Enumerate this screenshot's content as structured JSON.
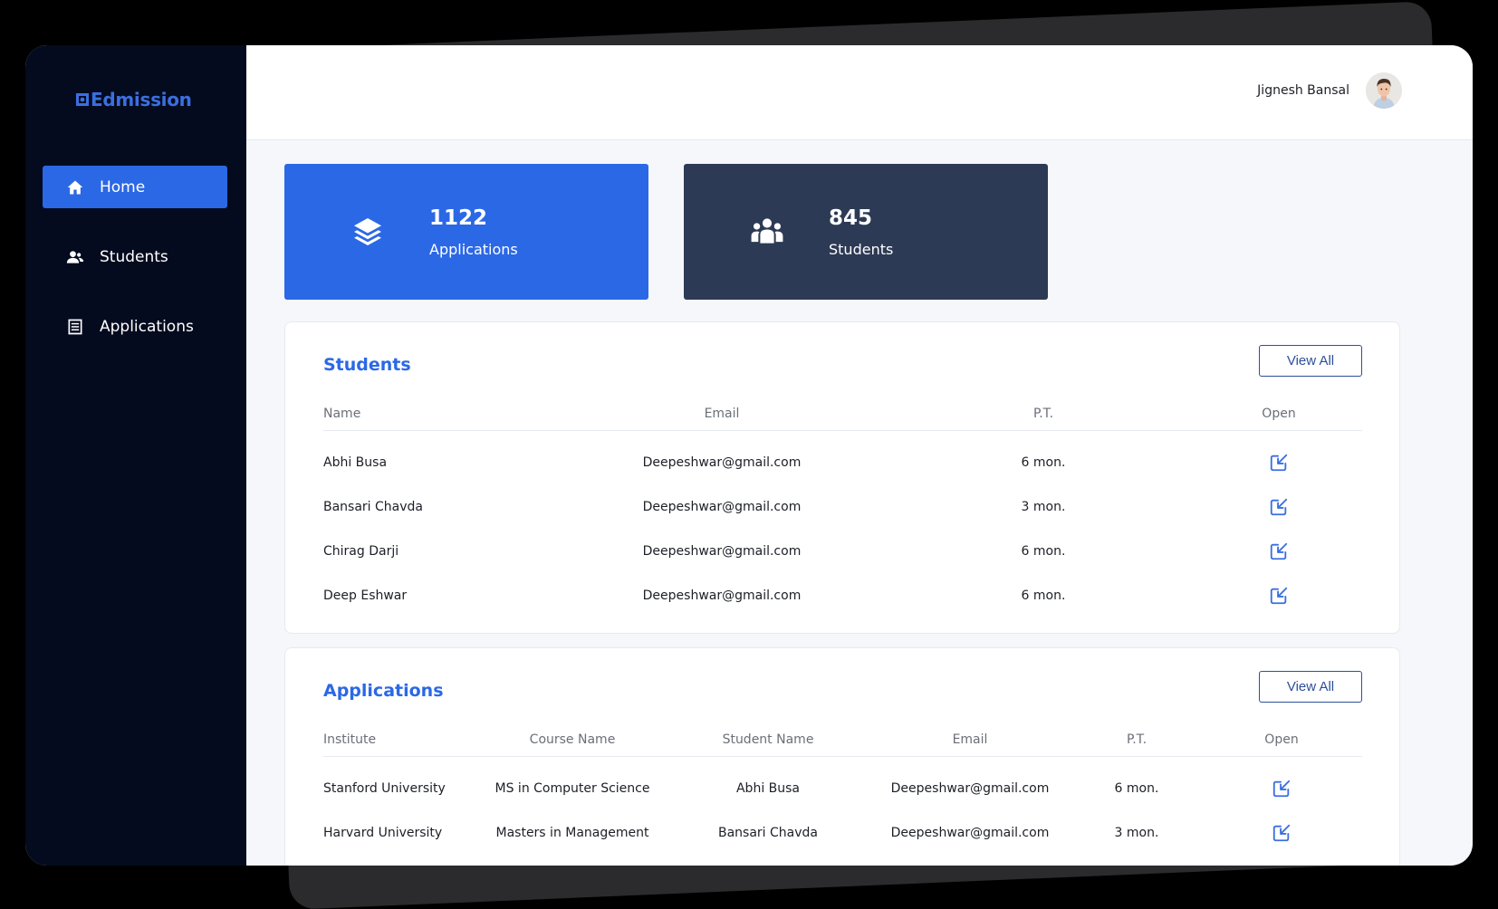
{
  "brand": {
    "name": "Edmission",
    "color": "#3b6fe0"
  },
  "sidebar": {
    "items": [
      {
        "label": "Home",
        "icon": "home-icon",
        "active": true
      },
      {
        "label": "Students",
        "icon": "users-icon",
        "active": false
      },
      {
        "label": "Applications",
        "icon": "list-icon",
        "active": false
      }
    ]
  },
  "header": {
    "user_name": "Jignesh Bansal"
  },
  "stats": [
    {
      "value": "1122",
      "label": "Applications",
      "icon": "layers-icon",
      "color": "#2b68e6"
    },
    {
      "value": "845",
      "label": "Students",
      "icon": "group-icon",
      "color": "#2d3a55"
    }
  ],
  "students": {
    "title": "Students",
    "view_all": "View All",
    "columns": [
      "Name",
      "Email",
      "P.T.",
      "Open"
    ],
    "rows": [
      {
        "name": "Abhi Busa",
        "email": "Deepeshwar@gmail.com",
        "pt": "6 mon."
      },
      {
        "name": "Bansari Chavda",
        "email": "Deepeshwar@gmail.com",
        "pt": "3 mon."
      },
      {
        "name": "Chirag Darji",
        "email": "Deepeshwar@gmail.com",
        "pt": "6 mon."
      },
      {
        "name": "Deep Eshwar",
        "email": "Deepeshwar@gmail.com",
        "pt": "6 mon."
      }
    ]
  },
  "applications": {
    "title": "Applications",
    "view_all": "View All",
    "columns": [
      "Institute",
      "Course Name",
      "Student Name",
      "Email",
      "P.T.",
      "Open"
    ],
    "rows": [
      {
        "institute": "Stanford University",
        "course": "MS in Computer Science",
        "student": "Abhi Busa",
        "email": "Deepeshwar@gmail.com",
        "pt": "6 mon."
      },
      {
        "institute": "Harvard University",
        "course": "Masters in Management",
        "student": "Bansari Chavda",
        "email": "Deepeshwar@gmail.com",
        "pt": "3 mon."
      }
    ]
  },
  "colors": {
    "accent": "#2b68e6",
    "sidebar_bg": "#040b1e",
    "navy_card": "#2d3a55",
    "open_icon": "#3b6fe0"
  }
}
